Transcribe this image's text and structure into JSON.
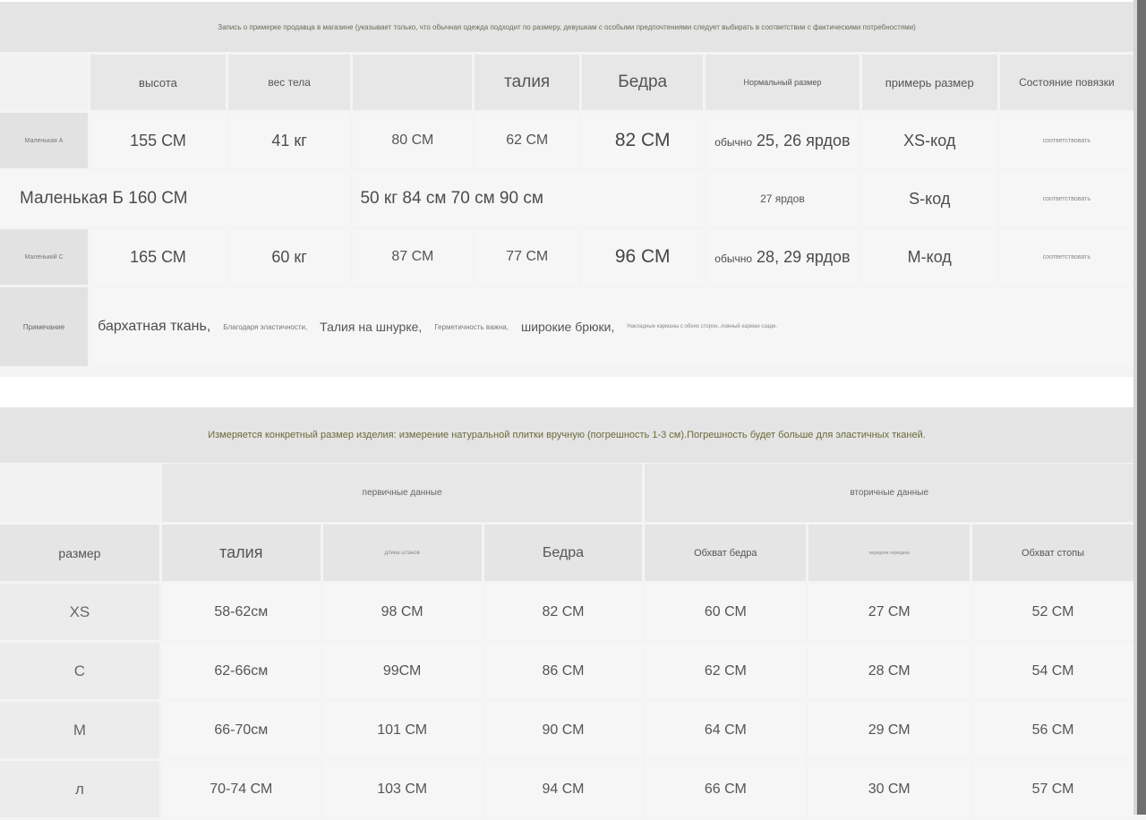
{
  "top_note": "Запись о примерке продавца в магазине (указывает только, что обычная одежда подходит по размеру, девушкам с особыми предпочтениями следует выбирать в соответствии с фактическими потребностями)",
  "fitting": {
    "headers": [
      "высота",
      "вес тела",
      "",
      "талия",
      "Бедра",
      "Нормальный размер",
      "примерь размер",
      "Состояние повязки"
    ],
    "rows": [
      {
        "label": "Маленькая А",
        "height": "155 СМ",
        "weight": "41 кг",
        "bust": "80 СМ",
        "waist": "62 СМ",
        "hips": "82 СМ",
        "normal_prefix": "обычно",
        "normal": "25, 26 ярдов",
        "try_size": "XS-код",
        "fit": "соответствовать"
      },
      {
        "merged": "Маленькая Б 160 СМ",
        "values_merged": "50 кг 84 см 70 см 90 см",
        "normal": "27 ярдов",
        "try_size": "S-код",
        "fit": "соответствовать"
      },
      {
        "label": "Маленький С",
        "height": "165 СМ",
        "weight": "60 кг",
        "bust": "87 СМ",
        "waist": "77 СМ",
        "hips": "96 СМ",
        "normal_prefix": "обычно",
        "normal": "28, 29 ярдов",
        "try_size": "М-код",
        "fit": "соответствовать"
      }
    ],
    "note_label": "Примечание",
    "notes": [
      "бархатная ткань,",
      "Благодаря эластичности,",
      "Талия на шнурке,",
      "Герметичность важна,",
      "широкие брюки,",
      "Накладные карманы с обеих сторон, ложный карман сзади."
    ]
  },
  "measure_note": "Измеряется конкретный размер изделия: измерение натуральной плитки вручную (погрешность 1-3 см).Погрешность будет больше для эластичных тканей.",
  "sizes": {
    "group_primary": "первичные данные",
    "group_secondary": "вторичные данные",
    "headers": [
      "размер",
      "талия",
      "длина штанов",
      "Бедра",
      "Обхват бедра",
      "передняя передача",
      "Обхват стопы"
    ],
    "rows": [
      [
        "XS",
        "58-62см",
        "98 СМ",
        "82 СМ",
        "60 СМ",
        "27 СМ",
        "52 СМ"
      ],
      [
        "С",
        "62-66см",
        "99СМ",
        "86 СМ",
        "62 СМ",
        "28 СМ",
        "54 СМ"
      ],
      [
        "М",
        "66-70см",
        "101 СМ",
        "90 СМ",
        "64 СМ",
        "29 СМ",
        "56 СМ"
      ],
      [
        "л",
        "70-74 СМ",
        "103 СМ",
        "94 СМ",
        "66 СМ",
        "30 СМ",
        "57 СМ"
      ]
    ]
  }
}
